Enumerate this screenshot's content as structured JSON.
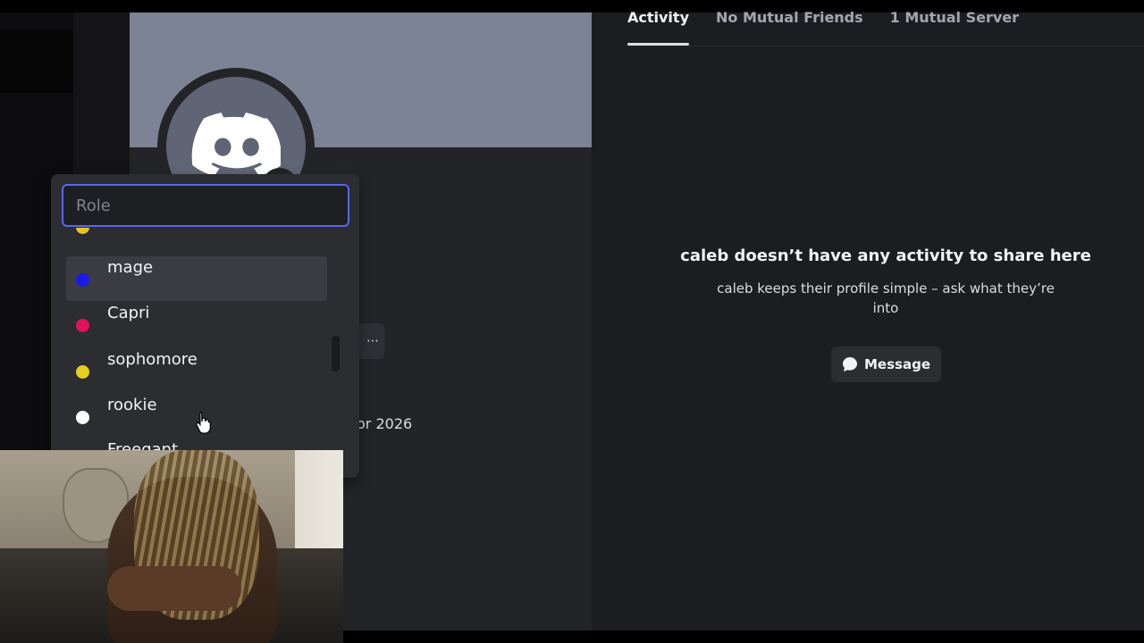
{
  "tabs": [
    {
      "label": "Activity",
      "active": true
    },
    {
      "label": "No Mutual Friends",
      "active": false
    },
    {
      "label": "1 Mutual Server",
      "active": false
    }
  ],
  "activity": {
    "title": "caleb doesn’t have any activity to share here",
    "subtitle": "caleb keeps their profile simple – ask what they’re into",
    "message_button": "Message"
  },
  "profile": {
    "member_since_fragment": "or 2026",
    "more_icon": "⋯"
  },
  "role_picker": {
    "placeholder": "Role",
    "value": "",
    "roles": [
      {
        "label": "",
        "color": "#e4c821"
      },
      {
        "label": "mage",
        "color": "#1a1ae6",
        "hover": true
      },
      {
        "label": "Capri",
        "color": "#e0125a"
      },
      {
        "label": "sophomore",
        "color": "#e7ce1b"
      },
      {
        "label": "rookie",
        "color": "#ffffff"
      },
      {
        "label": "Freegant",
        "color": "#8a8a8a"
      }
    ]
  }
}
